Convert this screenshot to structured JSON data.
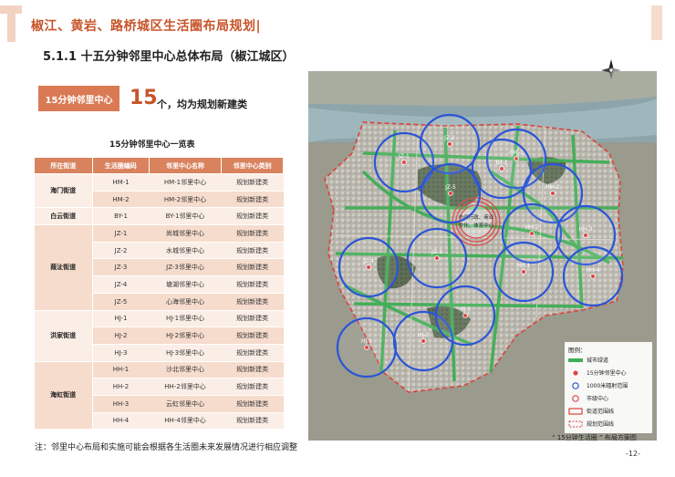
{
  "header": {
    "title": "椒江、黄岩、路桥城区生活圈布局规划|"
  },
  "section": {
    "title": "5.1.1 十五分钟邻里中心总体布局（椒江城区）"
  },
  "highlight": {
    "label": "15分钟邻里中心",
    "number": "15",
    "text": "个，均为规划新建类"
  },
  "table": {
    "title": "15分钟邻里中心一览表",
    "headers": [
      "所在街道",
      "生活圈编码",
      "邻里中心名称",
      "邻里中心类别"
    ],
    "groups": [
      {
        "street": "海门街道",
        "rows": [
          {
            "code": "HM-1",
            "name": "HM-1邻里中心",
            "type": "规划新建类"
          },
          {
            "code": "HM-2",
            "name": "HM-2邻里中心",
            "type": "规划新建类"
          }
        ]
      },
      {
        "street": "白云街道",
        "rows": [
          {
            "code": "BY-1",
            "name": "BY-1邻里中心",
            "type": "规划新建类"
          }
        ]
      },
      {
        "street": "葭沚街道",
        "rows": [
          {
            "code": "JZ-1",
            "name": "尚城邻里中心",
            "type": "规划新建类"
          },
          {
            "code": "JZ-2",
            "name": "水城邻里中心",
            "type": "规划新建类"
          },
          {
            "code": "JZ-3",
            "name": "JZ-3邻里中心",
            "type": "规划新建类"
          },
          {
            "code": "JZ-4",
            "name": "塘湖邻里中心",
            "type": "规划新建类"
          },
          {
            "code": "JZ-5",
            "name": "心海邻里中心",
            "type": "规划新建类"
          }
        ]
      },
      {
        "street": "洪家街道",
        "rows": [
          {
            "code": "HJ-1",
            "name": "HJ-1邻里中心",
            "type": "规划新建类"
          },
          {
            "code": "HJ-2",
            "name": "HJ-2邻里中心",
            "type": "规划新建类"
          },
          {
            "code": "HJ-3",
            "name": "HJ-3邻里中心",
            "type": "规划新建类"
          }
        ]
      },
      {
        "street": "海虹街道",
        "rows": [
          {
            "code": "HH-1",
            "name": "沙北邻里中心",
            "type": "规划新建类"
          },
          {
            "code": "HH-2",
            "name": "HH-2邻里中心",
            "type": "规划新建类"
          },
          {
            "code": "HH-3",
            "name": "云虹邻里中心",
            "type": "规划新建类"
          },
          {
            "code": "HH-4",
            "name": "HH-4邻里中心",
            "type": "规划新建类"
          }
        ]
      }
    ]
  },
  "note": "注：邻里中心布局和实施可能会根据各生活圈未来发展情况进行相应调整",
  "map": {
    "caption": "“ 15分钟生活圈 ” 布局方案图",
    "center_label_line1": "市级行政、商业",
    "center_label_line2": "文化、体育中心",
    "circle_labels": [
      "JZ-1",
      "JZ-2",
      "HM-1",
      "BY-1",
      "JZ-5",
      "HM-2",
      "JZ-4",
      "HH-2",
      "HH-3",
      "JZ-3",
      "HH-1",
      "HH-4",
      "HJ-1",
      "HJ-2",
      "HJ-3"
    ],
    "legend": {
      "title": "图例：",
      "items": [
        "城市绿道",
        "15分钟邻里中心",
        "1000米辐射范围",
        "市级中心",
        "街道范围线",
        "规划范围线"
      ]
    },
    "colors": {
      "greenway": "#3fae55",
      "circle": "#2a55d6",
      "center": "#e14444",
      "boundary": "#d9433c"
    }
  },
  "page_number": "-12-"
}
